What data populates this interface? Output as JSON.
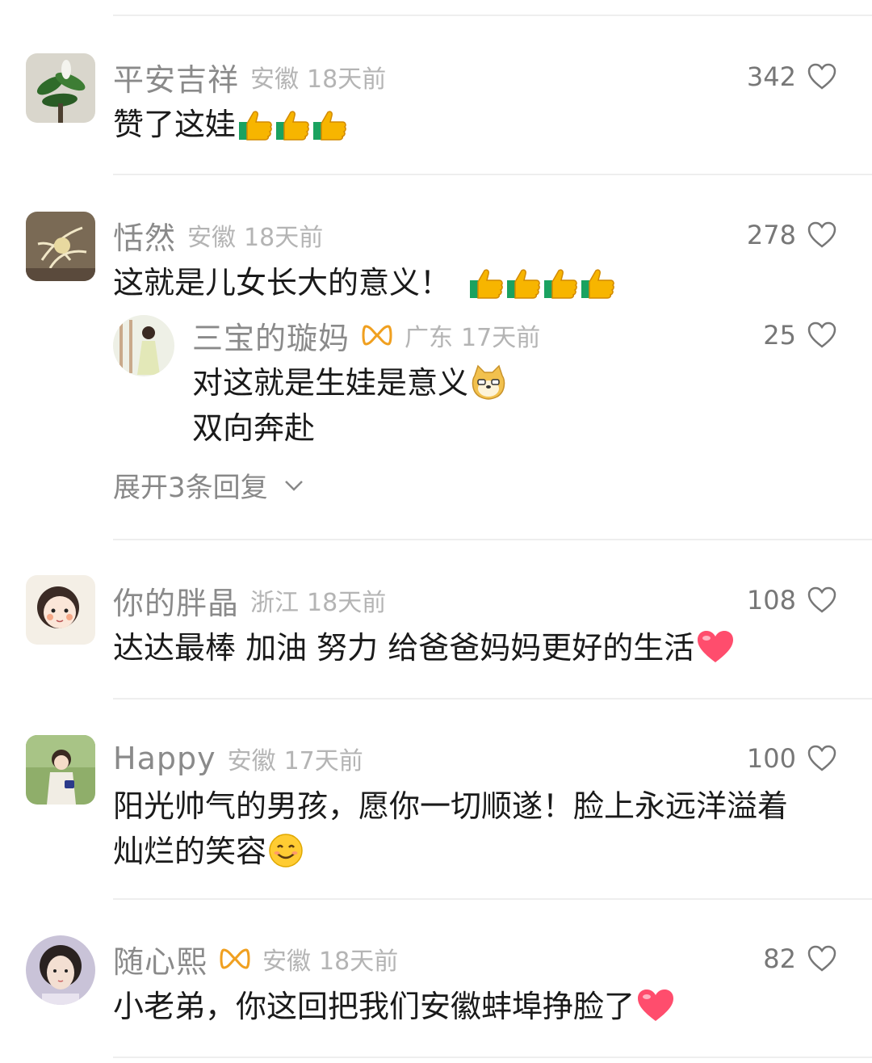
{
  "comments": [
    {
      "username": "平安吉祥",
      "location": "安徽",
      "time": "18天前",
      "likes": "342",
      "text": "赞了这娃"
    },
    {
      "username": "恬然",
      "location": "安徽",
      "time": "18天前",
      "likes": "278",
      "text": "这就是儿女长大的意义！",
      "reply": {
        "username": "三宝的璇妈",
        "location": "广东",
        "time": "17天前",
        "likes": "25",
        "line1": "对这就是生娃是意义",
        "line2": "双向奔赴"
      },
      "expand_label": "展开3条回复"
    },
    {
      "username": "你的胖晶",
      "location": "浙江",
      "time": "18天前",
      "likes": "108",
      "text": "达达最棒 加油 努力 给爸爸妈妈更好的生活"
    },
    {
      "username": "Happy",
      "location": "安徽",
      "time": "17天前",
      "likes": "100",
      "line1": "阳光帅气的男孩，愿你一切顺遂！脸上永远洋溢着",
      "line2": "灿烂的笑容"
    },
    {
      "username": "随心熙",
      "location": "安徽",
      "time": "18天前",
      "likes": "82",
      "text": "小老弟，你这回把我们安徽蚌埠挣脸了"
    }
  ],
  "colors": {
    "badge": "#f0a020",
    "heart_emoji": "#ff4d6d",
    "thumbs": "#f7b500"
  },
  "icons": {
    "like": "heart-outline-icon",
    "expand": "chevron-down-icon",
    "badge": "fan-badge-icon"
  }
}
